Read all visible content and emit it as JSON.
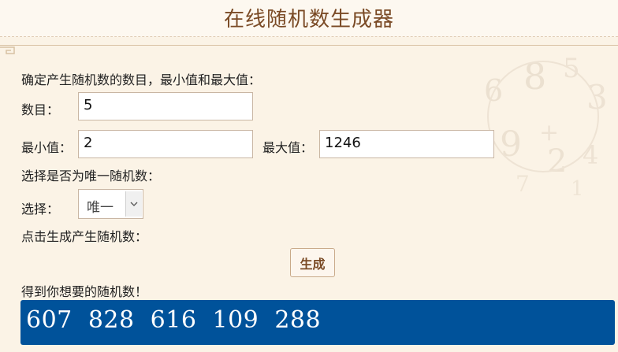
{
  "page_title": "在线随机数生成器",
  "intro": "确定产生随机数的数目，最小值和最大值：",
  "count": {
    "label": "数目：",
    "value": "5"
  },
  "min": {
    "label": "最小值：",
    "value": "2"
  },
  "max": {
    "label": "最大值：",
    "value": "1246"
  },
  "unique_prompt": "选择是否为唯一随机数：",
  "select": {
    "label": "选择：",
    "selected": "唯一"
  },
  "generate_prompt": "点击生成产生随机数：",
  "generate_button": "生成",
  "result_prompt": "得到你想要的随机数！",
  "result": "607  828  616  109  288",
  "colors": {
    "accent": "#00529a",
    "title": "#7a4a25",
    "background": "#fbf3e6"
  }
}
